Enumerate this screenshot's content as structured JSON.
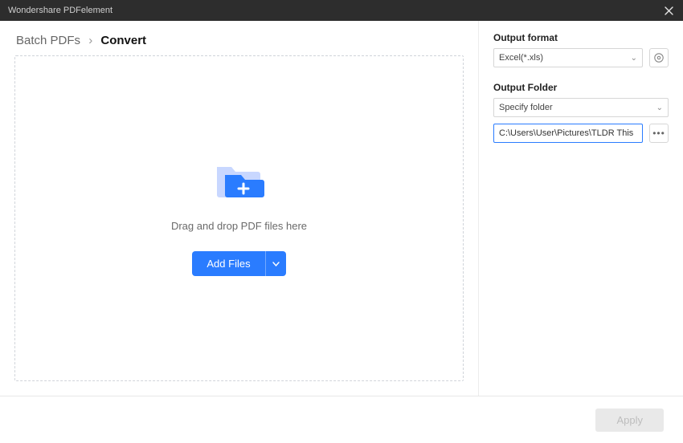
{
  "titlebar": {
    "title": "Wondershare PDFelement"
  },
  "breadcrumb": {
    "root": "Batch PDFs",
    "current": "Convert"
  },
  "dropzone": {
    "text": "Drag and drop PDF files here",
    "add_label": "Add Files"
  },
  "right": {
    "output_format_label": "Output format",
    "output_format_value": "Excel(*.xls)",
    "output_folder_label": "Output Folder",
    "output_folder_mode": "Specify folder",
    "output_folder_path": "C:\\Users\\User\\Pictures\\TLDR This"
  },
  "footer": {
    "apply_label": "Apply"
  }
}
